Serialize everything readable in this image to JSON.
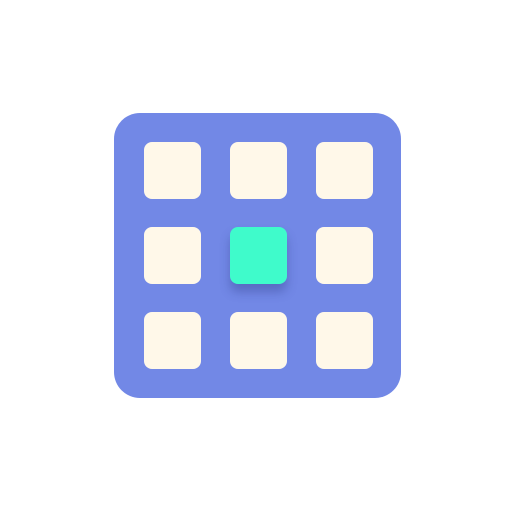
{
  "icon": {
    "name": "grid-app-icon",
    "colors": {
      "frame": "#7288e6",
      "tile": "#fff8e9",
      "tile_selected": "#3ffbcb",
      "background": "#ffffff"
    },
    "grid": {
      "rows": 3,
      "columns": 3,
      "selected_cell": {
        "row": 2,
        "column": 2
      }
    }
  }
}
